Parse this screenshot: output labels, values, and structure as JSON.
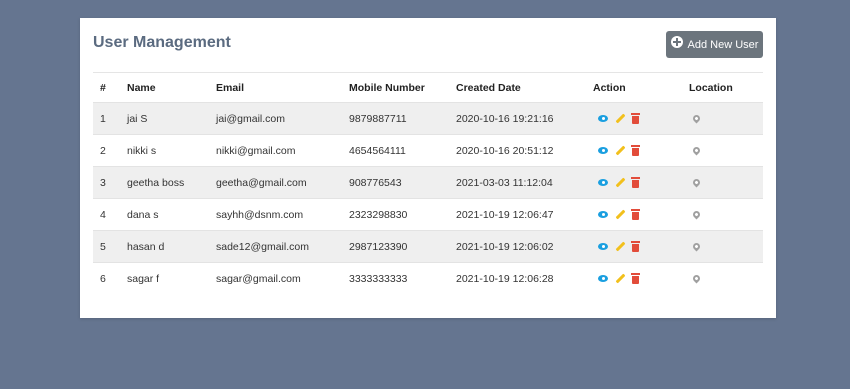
{
  "header": {
    "title": "User Management",
    "add_button_label": "Add New User"
  },
  "table": {
    "columns": [
      "#",
      "Name",
      "Email",
      "Mobile Number",
      "Created Date",
      "Action",
      "Location"
    ],
    "rows": [
      {
        "idx": "1",
        "name": "jai S",
        "email": "jai@gmail.com",
        "mobile": "9879887711",
        "created": "2020-10-16 19:21:16"
      },
      {
        "idx": "2",
        "name": "nikki s",
        "email": "nikki@gmail.com",
        "mobile": "4654564111",
        "created": "2020-10-16 20:51:12"
      },
      {
        "idx": "3",
        "name": "geetha boss",
        "email": "geetha@gmail.com",
        "mobile": "908776543",
        "created": "2021-03-03 11:12:04"
      },
      {
        "idx": "4",
        "name": "dana s",
        "email": "sayhh@dsnm.com",
        "mobile": "2323298830",
        "created": "2021-10-19 12:06:47"
      },
      {
        "idx": "5",
        "name": "hasan d",
        "email": "sade12@gmail.com",
        "mobile": "2987123390",
        "created": "2021-10-19 12:06:02"
      },
      {
        "idx": "6",
        "name": "sagar f",
        "email": "sagar@gmail.com",
        "mobile": "3333333333",
        "created": "2021-10-19 12:06:28"
      }
    ]
  },
  "icons": {
    "add": "plus-circle-icon",
    "view": "eye-icon",
    "edit": "pencil-icon",
    "delete": "trash-icon",
    "location": "map-pin-icon"
  },
  "colors": {
    "background": "#657590",
    "title": "#5b6b80",
    "button": "#6c757d",
    "view": "#1a9fe0",
    "edit": "#f2c01c",
    "delete": "#e24c3a",
    "location": "#a0a0a0"
  }
}
